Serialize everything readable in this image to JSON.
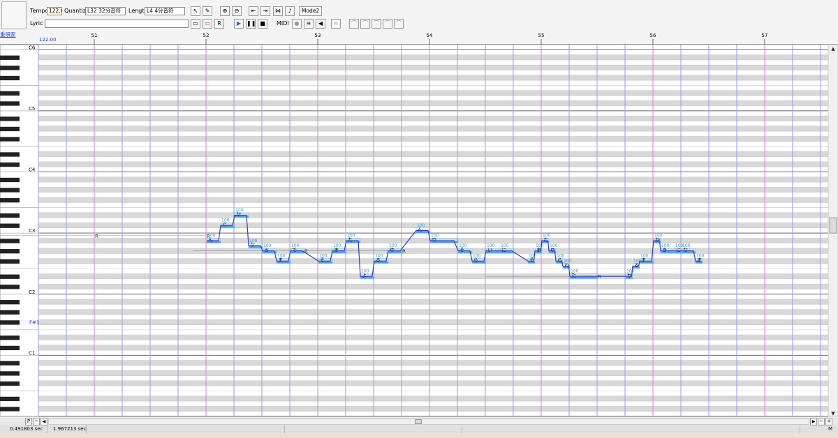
{
  "toolbar": {
    "tempo_label": "Tempo",
    "tempo_value": "122.0",
    "quantize_label": "Quantize",
    "quantize_value": "L32 32分音符",
    "length_label": "Length",
    "length_value": "L4  4分音符",
    "mode_button": "Mode2",
    "lyric_label": "Lyric",
    "lyric_value": "",
    "midi_label": "MIDI",
    "rest_button_label": "R"
  },
  "editor": {
    "singer_name": "重唄家",
    "tempo_marker": "122.00",
    "measures": [
      "51",
      "52",
      "53",
      "54",
      "55",
      "56",
      "57"
    ],
    "octave_labels": [
      "C6",
      "C5",
      "C4",
      "C3",
      "C2",
      "C1"
    ],
    "highlight_key_label": "F#1",
    "rest_label": "R",
    "note_velocity": "100",
    "colors": {
      "measure_line": "#e07be0",
      "beat_line": "#9a9af0",
      "note_bar": "#4aa0f0",
      "pitch_curve": "#2a3fc0",
      "velocity_text": "#3aa0e0",
      "black_row": "#d8d8d8",
      "white_row": "#ffffff"
    },
    "notes": [
      {
        "key": 46,
        "beat": 0.0,
        "dur": 0.5,
        "lyric": "ん"
      },
      {
        "key": 49,
        "beat": 0.5,
        "dur": 0.5,
        "lyric": "ぐ"
      },
      {
        "key": 51,
        "beat": 1.0,
        "dur": 0.5,
        "lyric": "か"
      },
      {
        "key": 45,
        "beat": 1.5,
        "dur": 0.5,
        "lyric": "な"
      },
      {
        "key": 44,
        "beat": 2.0,
        "dur": 0.5,
        "lyric": "る"
      },
      {
        "key": 42,
        "beat": 2.5,
        "dur": 0.5,
        "lyric": "ま"
      },
      {
        "key": 44,
        "beat": 3.0,
        "dur": 0.5,
        "lyric": "で"
      },
      {
        "key": 42,
        "beat": 4.0,
        "dur": 0.5,
        "lyric": "そ"
      },
      {
        "key": 44,
        "beat": 4.5,
        "dur": 0.5,
        "lyric": "ま"
      },
      {
        "key": 46,
        "beat": 5.0,
        "dur": 0.5,
        "lyric": "た"
      },
      {
        "key": 39,
        "beat": 5.5,
        "dur": 0.5,
        "lyric": "よ"
      },
      {
        "key": 42,
        "beat": 6.0,
        "dur": 0.5,
        "lyric": "る"
      },
      {
        "key": 44,
        "beat": 6.5,
        "dur": 0.5,
        "lyric": "ゆ"
      },
      {
        "key": 48,
        "beat": 7.5,
        "dur": 0.5,
        "lyric": "ん"
      },
      {
        "key": 46,
        "beat": 8.0,
        "dur": 1.0,
        "lyric": "の"
      },
      {
        "key": 44,
        "beat": 9.0,
        "dur": 0.5,
        "lyric": "そ"
      },
      {
        "key": 42,
        "beat": 9.5,
        "dur": 0.5,
        "lyric": "ら"
      },
      {
        "key": 44,
        "beat": 10.0,
        "dur": 0.5,
        "lyric": "い"
      },
      {
        "key": 44,
        "beat": 10.5,
        "dur": 0.5,
        "lyric": "に"
      },
      {
        "key": 42,
        "beat": 11.5,
        "dur": 0.25,
        "lyric": "そ"
      },
      {
        "key": 44,
        "beat": 11.75,
        "dur": 0.25,
        "lyric": "ま"
      },
      {
        "key": 46,
        "beat": 12.0,
        "dur": 0.25,
        "lyric": "た"
      },
      {
        "key": 44,
        "beat": 12.25,
        "dur": 0.25,
        "lyric": "ゆ"
      },
      {
        "key": 42,
        "beat": 12.5,
        "dur": 0.25,
        "lyric": "ら"
      },
      {
        "key": 41,
        "beat": 12.75,
        "dur": 0.25,
        "lyric": "わ"
      },
      {
        "key": 39,
        "beat": 13.0,
        "dur": 1.0,
        "lyric": "た"
      },
      {
        "key": 39,
        "beat": 15.0,
        "dur": 0.25,
        "lyric": "か"
      },
      {
        "key": 41,
        "beat": 15.25,
        "dur": 0.25,
        "lyric": "る"
      },
      {
        "key": 42,
        "beat": 15.5,
        "dur": 0.5,
        "lyric": "ま"
      },
      {
        "key": 46,
        "beat": 16.0,
        "dur": 0.25,
        "lyric": "か"
      },
      {
        "key": 44,
        "beat": 16.25,
        "dur": 0.5,
        "lyric": "き"
      },
      {
        "key": 44,
        "beat": 16.75,
        "dur": 0.25,
        "lyric": "に"
      },
      {
        "key": 44,
        "beat": 17.0,
        "dur": 0.5,
        "lyric": "な"
      },
      {
        "key": 42,
        "beat": 17.5,
        "dur": 0.25,
        "lyric": "ま"
      }
    ],
    "rests": [
      {
        "key": 47,
        "beat": -4.0
      },
      {
        "key": 47,
        "beat": 0.0
      },
      {
        "key": 44,
        "beat": 3.5
      },
      {
        "key": 44,
        "beat": 7.0
      },
      {
        "key": 39,
        "beat": 14.0
      }
    ]
  },
  "statusbar": {
    "position_sec": "0.491803 sec",
    "duration_sec": "1.967213 sec"
  },
  "scrollbar": {
    "left_button": "P",
    "mode_button": "M"
  }
}
